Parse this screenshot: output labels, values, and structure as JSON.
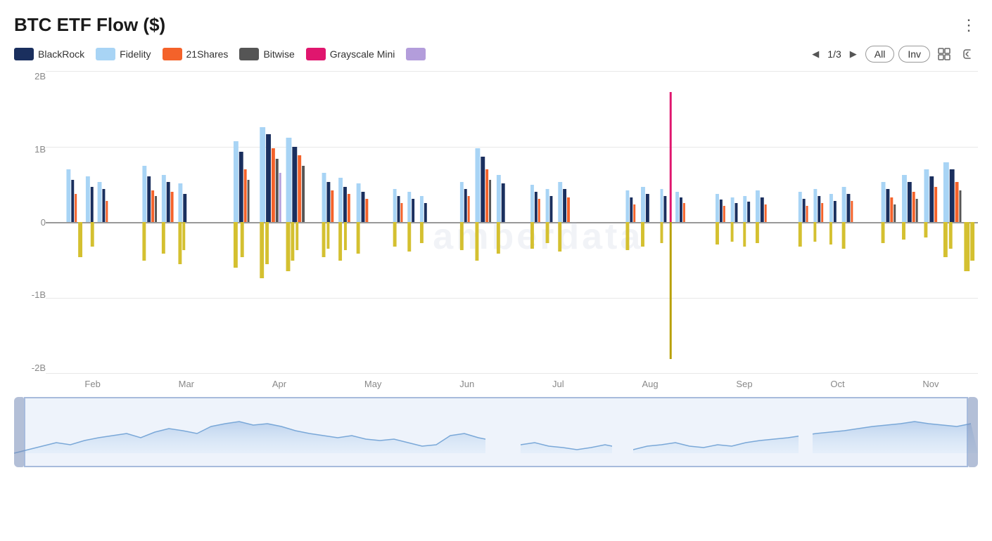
{
  "header": {
    "title": "BTC ETF Flow ($)",
    "menu_label": "⋮"
  },
  "legend": {
    "items": [
      {
        "id": "blackrock",
        "label": "BlackRock",
        "color": "#1a2f5e",
        "swatch_class": "blackrock"
      },
      {
        "id": "fidelity",
        "label": "Fidelity",
        "color": "#a8d4f5",
        "swatch_class": "fidelity"
      },
      {
        "id": "shares21",
        "label": "21Shares",
        "color": "#f4622a",
        "swatch_class": "shares21"
      },
      {
        "id": "bitwise",
        "label": "Bitwise",
        "color": "#555555",
        "swatch_class": "bitwise"
      },
      {
        "id": "grayscale_mini",
        "label": "Grayscale Mini",
        "color": "#e0166e",
        "swatch_class": "grayscale-mini"
      },
      {
        "id": "purple",
        "label": "",
        "color": "#b39ddb",
        "swatch_class": "purple"
      }
    ]
  },
  "pagination": {
    "current": "1/3",
    "prev": "◀",
    "next": "▶"
  },
  "controls": {
    "all_label": "All",
    "inv_label": "Inv",
    "expand_icon": "⊡",
    "back_icon": "↩"
  },
  "yaxis": {
    "labels": [
      "2B",
      "1B",
      "0",
      "-1B",
      "-2B"
    ]
  },
  "xaxis": {
    "labels": [
      "Feb",
      "Mar",
      "Apr",
      "May",
      "Jun",
      "Jul",
      "Aug",
      "Sep",
      "Oct",
      "Nov"
    ]
  },
  "watermark": "amberdata"
}
